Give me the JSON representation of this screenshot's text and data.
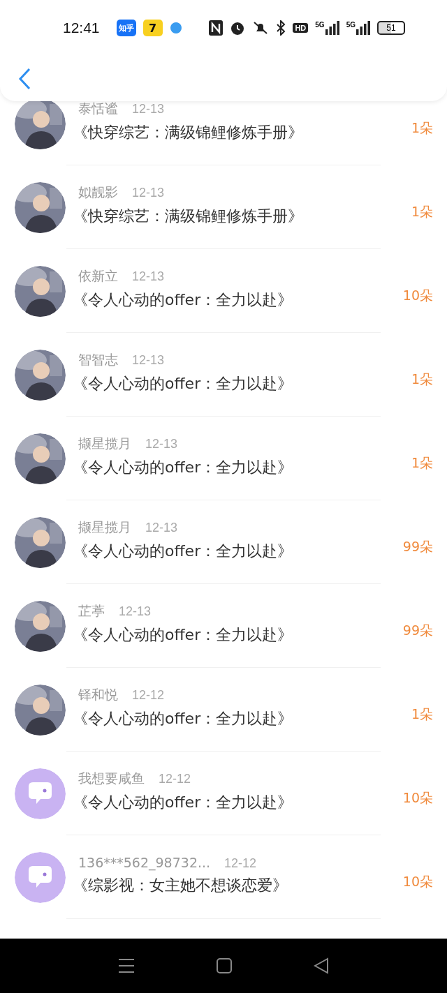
{
  "status_bar": {
    "time": "12:41",
    "apps": [
      {
        "kind": "zhihu",
        "label": "知乎"
      },
      {
        "kind": "cat",
        "label": "7"
      },
      {
        "kind": "bubble"
      }
    ],
    "hd_label": "HD",
    "signals": [
      {
        "label": "5G"
      },
      {
        "label": "5G"
      }
    ],
    "battery": "51"
  },
  "rows": [
    {
      "name": "泰恬谧",
      "date": "12-13",
      "title": "《快穿综艺：满级锦鲤修炼手册》",
      "count": "1朵"
    },
    {
      "name": "姒靓影",
      "date": "12-13",
      "title": "《快穿综艺：满级锦鲤修炼手册》",
      "count": "1朵"
    },
    {
      "name": "依新立",
      "date": "12-13",
      "title": "《令人心动的offer：全力以赴》",
      "count": "10朵"
    },
    {
      "name": "智智志",
      "date": "12-13",
      "title": "《令人心动的offer：全力以赴》",
      "count": "1朵"
    },
    {
      "name": "撷星揽月",
      "date": "12-13",
      "title": "《令人心动的offer：全力以赴》",
      "count": "1朵"
    },
    {
      "name": "撷星揽月",
      "date": "12-13",
      "title": "《令人心动的offer：全力以赴》",
      "count": "99朵"
    },
    {
      "name": "芷葶",
      "date": "12-13",
      "title": "《令人心动的offer：全力以赴》",
      "count": "99朵"
    },
    {
      "name": "铎和悦",
      "date": "12-12",
      "title": "《令人心动的offer：全力以赴》",
      "count": "1朵"
    },
    {
      "name": "我想要咸鱼",
      "date": "12-12",
      "title": "《令人心动的offer：全力以赴》",
      "count": "10朵",
      "avatar": {
        "kind": "default"
      }
    },
    {
      "name": "136***562_98732...",
      "date": "12-12",
      "title": "《综影视：女主她不想谈恋爱》",
      "count": "10朵",
      "avatar": {
        "kind": "default"
      }
    }
  ]
}
